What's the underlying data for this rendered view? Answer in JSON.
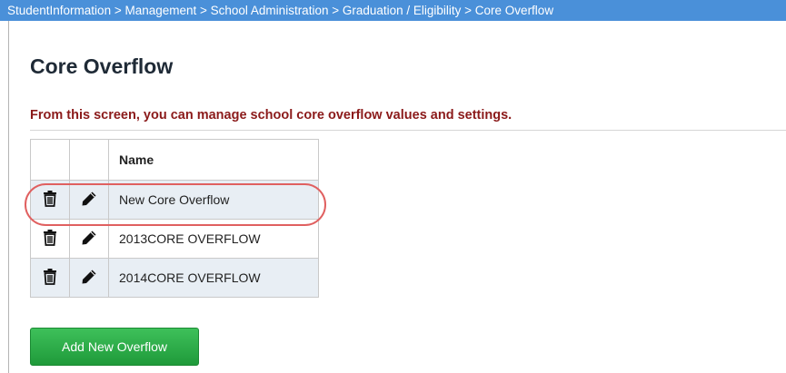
{
  "breadcrumb": "StudentInformation > Management > School Administration > Graduation / Eligibility > Core Overflow",
  "page_title": "Core Overflow",
  "subtitle": "From this screen, you can manage school core overflow values and settings.",
  "table": {
    "header_name": "Name",
    "rows": [
      {
        "name": "New Core Overflow"
      },
      {
        "name": "2013CORE OVERFLOW"
      },
      {
        "name": "2014CORE OVERFLOW"
      }
    ]
  },
  "add_button_label": "Add New Overflow",
  "colors": {
    "breadcrumb_bg": "#4a90d9",
    "subtitle": "#8b1a1a",
    "highlight": "#e06060",
    "button": "#2aab45"
  },
  "icons": {
    "delete": "trash-icon",
    "edit": "pencil-icon"
  }
}
